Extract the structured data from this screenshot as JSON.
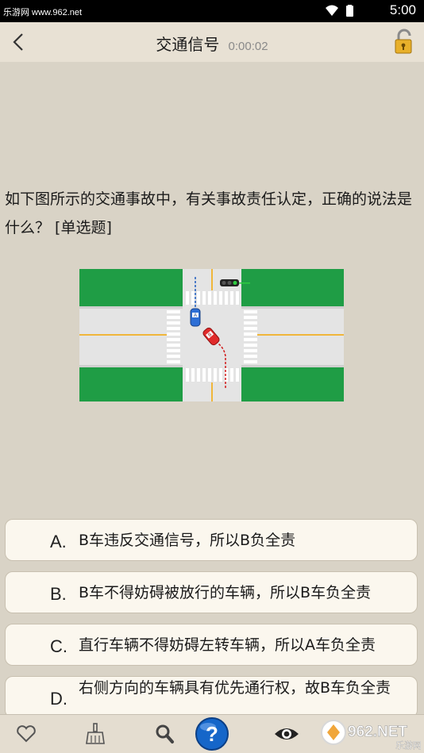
{
  "status": {
    "watermark": "乐游网 www.962.net",
    "time": "5:00"
  },
  "header": {
    "title": "交通信号",
    "timer": "0:00:02"
  },
  "question": {
    "text": "如下图所示的交通事故中，有关事故责任认定，正确的说法是什么？ [单选题]"
  },
  "options": [
    {
      "letter": "A.",
      "text": "B车违反交通信号，所以B负全责"
    },
    {
      "letter": "B.",
      "text": "B车不得妨碍被放行的车辆，所以B车负全责"
    },
    {
      "letter": "C.",
      "text": "直行车辆不得妨碍左转车辆，所以A车负全责"
    },
    {
      "letter": "D.",
      "text": "右侧方向的车辆具有优先通行权，故B车负全责"
    }
  ],
  "figure": {
    "car_a": "A",
    "car_b": "B"
  },
  "bottom_icons": [
    "heart-icon",
    "broom-icon",
    "search-icon",
    "help-icon",
    "eye-icon"
  ],
  "watermark_logo": {
    "brand": "962.NET",
    "caption": "乐游网"
  },
  "colors": {
    "background": "#d9d3c6",
    "grass": "#1f9d45",
    "road": "#e4e4e4",
    "help_blue": "#1566c9"
  }
}
